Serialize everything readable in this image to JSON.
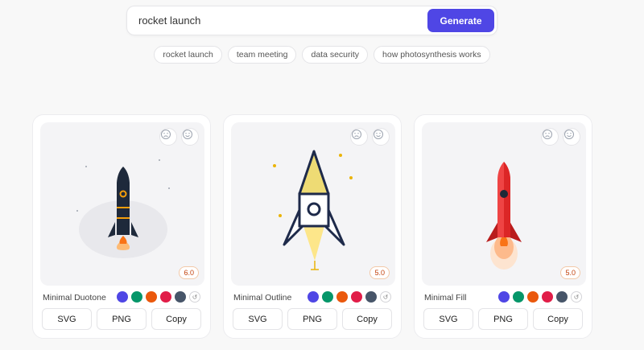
{
  "search": {
    "value": "rocket launch",
    "generate_label": "Generate"
  },
  "suggestions": [
    "rocket launch",
    "team meeting",
    "data security",
    "how photosynthesis works"
  ],
  "cards": [
    {
      "style_name": "Minimal Duotone",
      "score": "6.0",
      "swatches": [
        "#4f46e5",
        "#059669",
        "#ea580c",
        "#e11d48",
        "#475569"
      ],
      "reset_icon": "↺",
      "buttons": [
        "SVG",
        "PNG",
        "Copy"
      ]
    },
    {
      "style_name": "Minimal Outline",
      "score": "5.0",
      "swatches": [
        "#4f46e5",
        "#059669",
        "#ea580c",
        "#e11d48",
        "#475569"
      ],
      "reset_icon": "↺",
      "buttons": [
        "SVG",
        "PNG",
        "Copy"
      ]
    },
    {
      "style_name": "Minimal Fill",
      "score": "5.0",
      "swatches": [
        "#4f46e5",
        "#059669",
        "#ea580c",
        "#e11d48",
        "#475569"
      ],
      "reset_icon": "↺",
      "buttons": [
        "SVG",
        "PNG",
        "Copy"
      ]
    }
  ],
  "colors": {
    "accent": "#4f46e5",
    "page_bg": "#f8f8f8",
    "preview_bg": "#f4f4f6"
  }
}
